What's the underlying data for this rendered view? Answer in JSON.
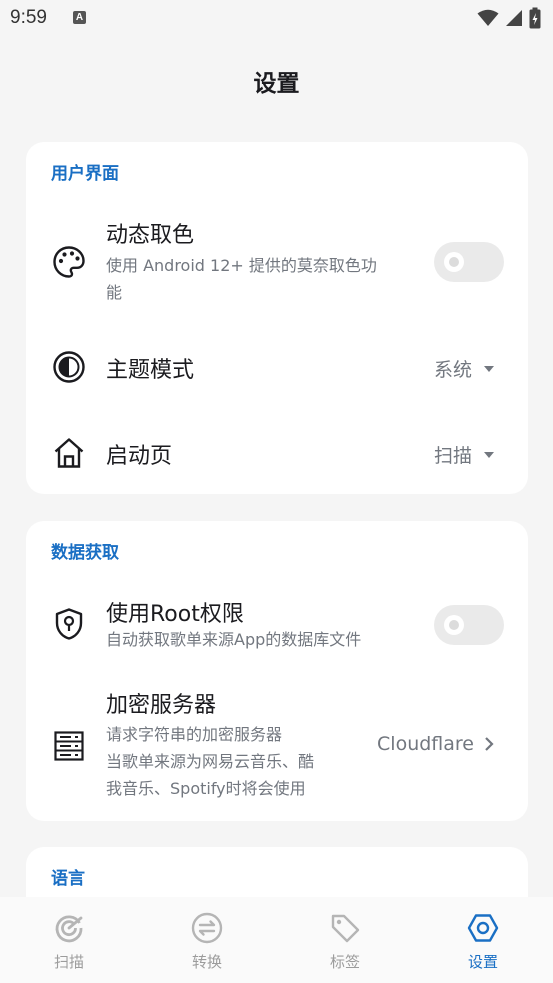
{
  "status_bar": {
    "time": "9:59",
    "notification_letter": "A"
  },
  "page_title": "设置",
  "sections": {
    "ui": {
      "title": "用户界面",
      "dynamic_color": {
        "title": "动态取色",
        "desc_line1": "使用 Android 12+ 提供的莫奈取色功",
        "desc_line2": "能",
        "enabled": false
      },
      "theme_mode": {
        "title": "主题模式",
        "value": "系统"
      },
      "start_page": {
        "title": "启动页",
        "value": "扫描"
      }
    },
    "data": {
      "title": "数据获取",
      "root": {
        "title": "使用Root权限",
        "desc": "自动获取歌单来源App的数据库文件",
        "enabled": false
      },
      "encrypt_server": {
        "title": "加密服务器",
        "desc_line1": "请求字符串的加密服务器",
        "desc_line2": "当歌单来源为网易云音乐、酷",
        "desc_line3": "我音乐、Spotify时将会使用",
        "value": "Cloudflare"
      }
    },
    "language": {
      "title": "语言"
    }
  },
  "bottom_nav": {
    "items": [
      {
        "label": "扫描",
        "icon": "scan-icon",
        "active": false
      },
      {
        "label": "转换",
        "icon": "convert-icon",
        "active": false
      },
      {
        "label": "标签",
        "icon": "tag-icon",
        "active": false
      },
      {
        "label": "设置",
        "icon": "settings-icon",
        "active": true
      }
    ]
  },
  "colors": {
    "accent": "#1a6fc4",
    "background": "#f5f5f5",
    "card": "#ffffff",
    "secondary_text": "#72777f"
  }
}
